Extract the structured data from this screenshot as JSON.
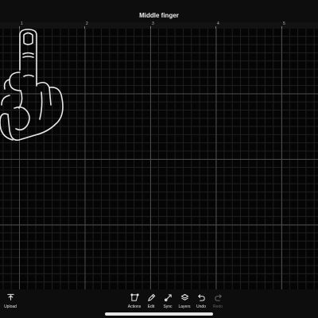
{
  "header": {
    "title": "Middle finger"
  },
  "ruler": {
    "labels": [
      "1",
      "2",
      "3",
      "4",
      "5"
    ]
  },
  "canvas": {
    "artwork_name": "hand-middle-finger"
  },
  "toolbar": {
    "upload_label": "Upload",
    "items": [
      {
        "label": "Actions",
        "icon": "actions-icon",
        "enabled": true
      },
      {
        "label": "Edit",
        "icon": "edit-icon",
        "enabled": true
      },
      {
        "label": "Sync",
        "icon": "sync-icon",
        "enabled": true
      },
      {
        "label": "Layers",
        "icon": "layers-icon",
        "enabled": true
      },
      {
        "label": "Undo",
        "icon": "undo-icon",
        "enabled": true
      },
      {
        "label": "Redo",
        "icon": "redo-icon",
        "enabled": false
      }
    ]
  },
  "colors": {
    "background": "#000000",
    "grid_major": "#4a4a4a",
    "grid_minor": "#1f1f1f",
    "stroke": "#e8e8e8"
  }
}
